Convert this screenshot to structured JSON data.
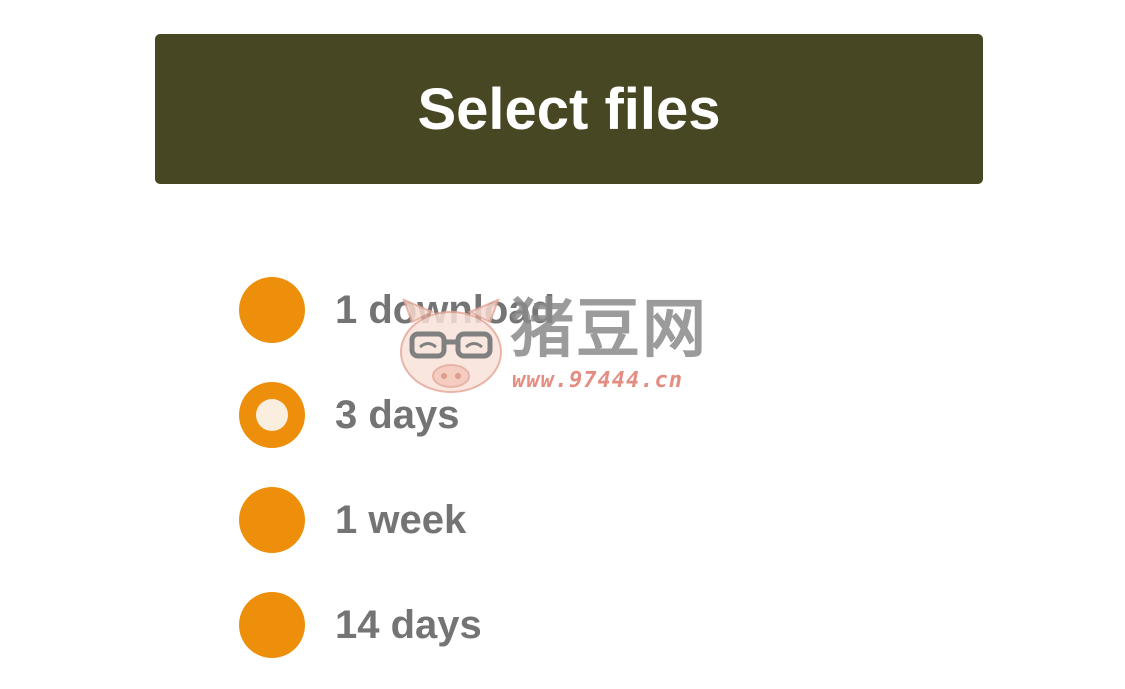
{
  "upload": {
    "select_label": "Select files"
  },
  "expiry": {
    "selected_index": 1,
    "options": [
      {
        "label": "1 download"
      },
      {
        "label": "3 days"
      },
      {
        "label": "1 week"
      },
      {
        "label": "14 days"
      }
    ]
  },
  "watermark": {
    "brand": "猪豆网",
    "url": "www.97444.cn",
    "icon": "pig-glasses-icon"
  },
  "colors": {
    "button_bg": "#474723",
    "radio": "#ee8f0b",
    "label": "#747474"
  }
}
